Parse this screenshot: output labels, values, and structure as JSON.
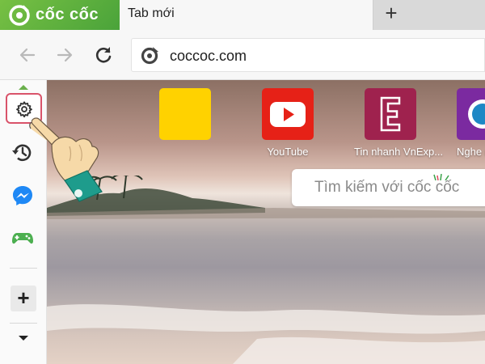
{
  "brand": {
    "name": "cốc cốc",
    "logo_icon": "coccoc-logo-icon",
    "color": "#6ab04c"
  },
  "tabs": [
    {
      "title": "Tab mới",
      "active": true
    }
  ],
  "new_tab_label": "+",
  "toolbar": {
    "back_icon": "arrow-left-icon",
    "forward_icon": "arrow-right-icon",
    "reload_icon": "reload-icon",
    "url": "coccoc.com"
  },
  "sidebar": {
    "items": [
      {
        "name": "settings",
        "icon": "gear-icon",
        "highlighted": true
      },
      {
        "name": "history",
        "icon": "history-icon"
      },
      {
        "name": "messenger",
        "icon": "messenger-icon"
      },
      {
        "name": "games",
        "icon": "gamepad-icon"
      }
    ],
    "add_label": "+"
  },
  "speed_dial": [
    {
      "label": "",
      "color": "#ffd200"
    },
    {
      "label": "YouTube",
      "color": "#e62117",
      "icon": "play-icon"
    },
    {
      "label": "Tin nhanh VnExp...",
      "color": "#9f224e",
      "icon": "letter-e-icon"
    },
    {
      "label": "Nghe nh",
      "color": "#7b2aa0"
    }
  ],
  "search": {
    "placeholder": "Tìm kiếm với cốc cốc"
  },
  "colors": {
    "highlight_border": "#d9536a",
    "sleeve": "#1e9c8c",
    "skin": "#f6d9a8"
  }
}
